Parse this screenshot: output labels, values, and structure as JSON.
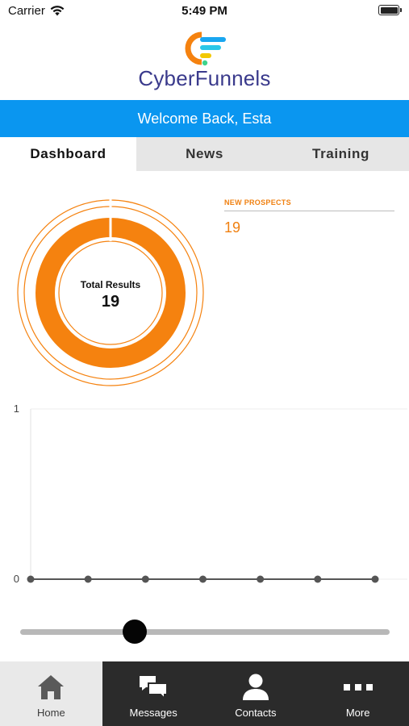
{
  "status_bar": {
    "carrier": "Carrier",
    "time": "5:49 PM"
  },
  "brand": {
    "name": "CyberFunnels",
    "color": "#3a3a8c"
  },
  "welcome": {
    "text": "Welcome Back, Esta",
    "color": "#0a96f0"
  },
  "tabs": [
    {
      "label": "Dashboard",
      "active": true
    },
    {
      "label": "News",
      "active": false
    },
    {
      "label": "Training",
      "active": false
    }
  ],
  "summary": {
    "total_label": "Total Results",
    "total_value": "19",
    "accent_color": "#f5820f"
  },
  "prospects": {
    "label": "NEW PROSPECTS",
    "value": "19"
  },
  "chart_data": {
    "type": "line",
    "x": [
      1,
      2,
      3,
      4,
      5,
      6,
      7
    ],
    "series": [
      {
        "values": [
          0,
          0,
          0,
          0,
          0,
          0,
          0
        ]
      }
    ],
    "ylim": [
      0,
      1
    ],
    "y_tick_labels": [
      "0",
      "1"
    ],
    "grid": true
  },
  "slider": {
    "value": 0.31
  },
  "bottom_nav": [
    {
      "label": "Home",
      "icon": "home-icon",
      "active": true
    },
    {
      "label": "Messages",
      "icon": "messages-icon",
      "active": false
    },
    {
      "label": "Contacts",
      "icon": "contacts-icon",
      "active": false
    },
    {
      "label": "More",
      "icon": "more-icon",
      "active": false
    }
  ]
}
